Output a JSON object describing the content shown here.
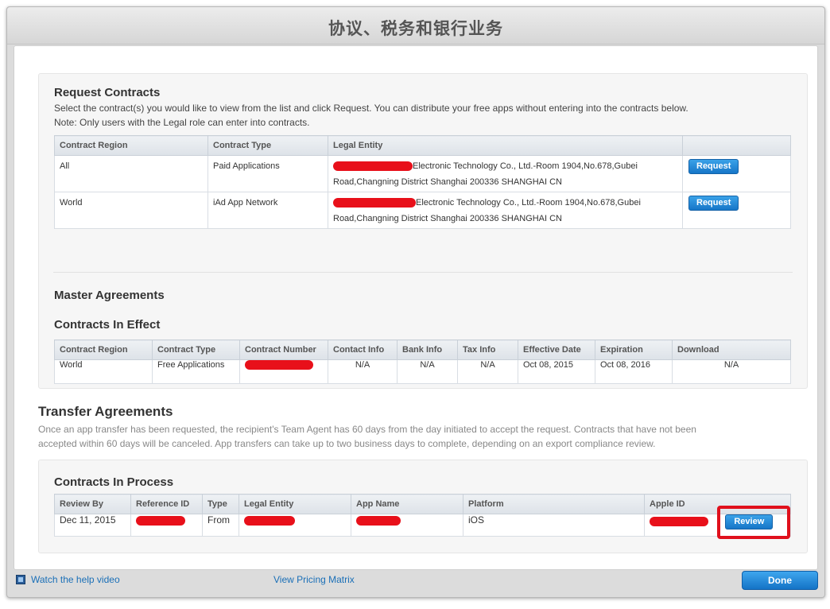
{
  "window": {
    "title": "协议、税务和银行业务"
  },
  "request_contracts": {
    "heading": "Request Contracts",
    "description_line1": "Select the contract(s) you would like to view from the list and click Request. You can distribute your free apps without entering into the contracts below.",
    "description_line2": "Note: Only users with the Legal role can enter into contracts.",
    "columns": [
      "Contract Region",
      "Contract Type",
      "Legal Entity"
    ],
    "rows": [
      {
        "region": "All",
        "type": "Paid Applications",
        "entity_line1": "Electronic Technology Co., Ltd.-Room 1904,No.678,Gubei",
        "entity_line2": "Road,Changning District Shanghai 200336 SHANGHAI CN",
        "button": "Request"
      },
      {
        "region": "World",
        "type": "iAd App Network",
        "entity_line1": "Electronic Technology Co., Ltd.-Room 1904,No.678,Gubei",
        "entity_line2": "Road,Changning District Shanghai 200336 SHANGHAI CN",
        "button": "Request"
      }
    ]
  },
  "master_agreements": {
    "heading": "Master Agreements",
    "subheading": "Contracts In Effect",
    "columns": [
      "Contract Region",
      "Contract Type",
      "Contract Number",
      "Contact Info",
      "Bank Info",
      "Tax Info",
      "Effective Date",
      "Expiration",
      "Download"
    ],
    "row": {
      "region": "World",
      "type": "Free Applications",
      "contact_info": "N/A",
      "bank_info": "N/A",
      "tax_info": "N/A",
      "effective_date": "Oct 08, 2015",
      "expiration": "Oct 08, 2016",
      "download": "N/A"
    }
  },
  "transfer_agreements": {
    "heading": "Transfer Agreements",
    "description_line1": "Once an app transfer has been requested, the recipient's Team Agent has 60 days from the day initiated to accept the request. Contracts that have not been",
    "description_line2": "accepted within 60 days will be canceled. App transfers can take up to two business days to complete, depending on an export compliance review."
  },
  "contracts_in_process": {
    "heading": "Contracts In Process",
    "columns": [
      "Review By",
      "Reference ID",
      "Type",
      "Legal Entity",
      "App Name",
      "Platform",
      "Apple ID"
    ],
    "row": {
      "review_by": "Dec 11, 2015",
      "type": "From",
      "platform": "iOS",
      "button": "Review"
    }
  },
  "footer": {
    "help_video": "Watch the help video",
    "pricing_matrix": "View Pricing Matrix",
    "done": "Done"
  },
  "colors": {
    "redaction": "#e8101a",
    "button_blue": "#1676c8",
    "link": "#1a6fb7",
    "highlight": "#e0101c"
  },
  "icons": {
    "help_video": "film-icon"
  }
}
